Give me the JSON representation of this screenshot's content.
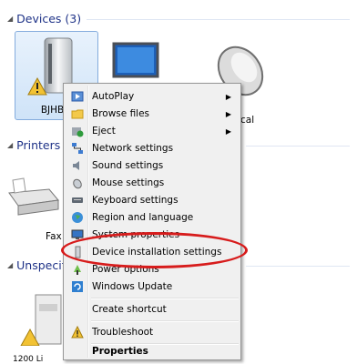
{
  "groups": {
    "devices": "Devices (3)",
    "printers": "Printers a",
    "unspecified": "Unspecifi"
  },
  "devices": {
    "selected_label": "BJHB-I",
    "mouse_label": "cal",
    "fax_label": "Fax",
    "unspec_label": "1200 Li"
  },
  "menu": {
    "items": [
      {
        "label": "AutoPlay",
        "icon": "autoplay-icon",
        "submenu": true
      },
      {
        "label": "Browse files",
        "icon": "folder-icon",
        "submenu": true
      },
      {
        "label": "Eject",
        "icon": "eject-icon",
        "submenu": true
      },
      {
        "label": "Network settings",
        "icon": "network-icon"
      },
      {
        "label": "Sound settings",
        "icon": "speaker-icon"
      },
      {
        "label": "Mouse settings",
        "icon": "mouse-icon"
      },
      {
        "label": "Keyboard settings",
        "icon": "keyboard-icon"
      },
      {
        "label": "Region and language",
        "icon": "globe-icon"
      },
      {
        "label": "System properties",
        "icon": "computer-icon"
      },
      {
        "label": "Device installation settings",
        "icon": "device-install-icon"
      },
      {
        "label": "Power options",
        "icon": "power-icon"
      },
      {
        "label": "Windows Update",
        "icon": "windows-update-icon"
      },
      {
        "label": "Create shortcut"
      },
      {
        "label": "Troubleshoot",
        "icon": "warning-icon"
      },
      {
        "label": "Properties",
        "bold": true
      }
    ]
  },
  "colors": {
    "highlight_circle": "#d71c1c",
    "group_heading": "#1e3287"
  }
}
